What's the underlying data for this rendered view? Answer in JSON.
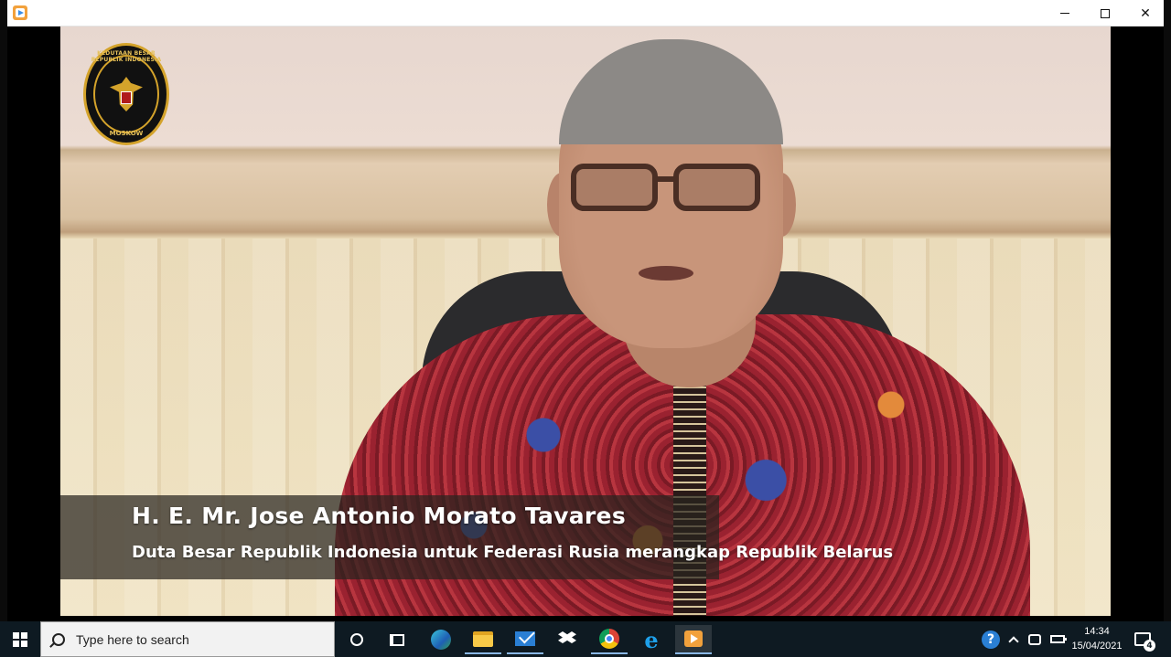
{
  "window": {
    "app_icon": "media-player-icon",
    "controls": [
      "minimize",
      "maximize",
      "close"
    ]
  },
  "video": {
    "logo": {
      "top_text": "KEDUTAAN BESAR REPUBLIK INDONESIA",
      "bottom_text": "MOSKOW"
    },
    "caption": {
      "name": "H. E. Mr. Jose Antonio Morato Tavares",
      "title": "Duta Besar Republik Indonesia untuk Federasi Rusia merangkap Republik Belarus"
    }
  },
  "taskbar": {
    "search_placeholder": "Type here to search",
    "pinned": [
      "cortana-icon",
      "task-view-icon",
      "edge-icon",
      "file-explorer-icon",
      "mail-icon",
      "dropbox-icon",
      "chrome-icon",
      "internet-explorer-icon",
      "media-player-icon"
    ],
    "active_app": "media-player-icon",
    "tray": {
      "time": "14:34",
      "date": "15/04/2021",
      "notification_count": "4"
    }
  }
}
